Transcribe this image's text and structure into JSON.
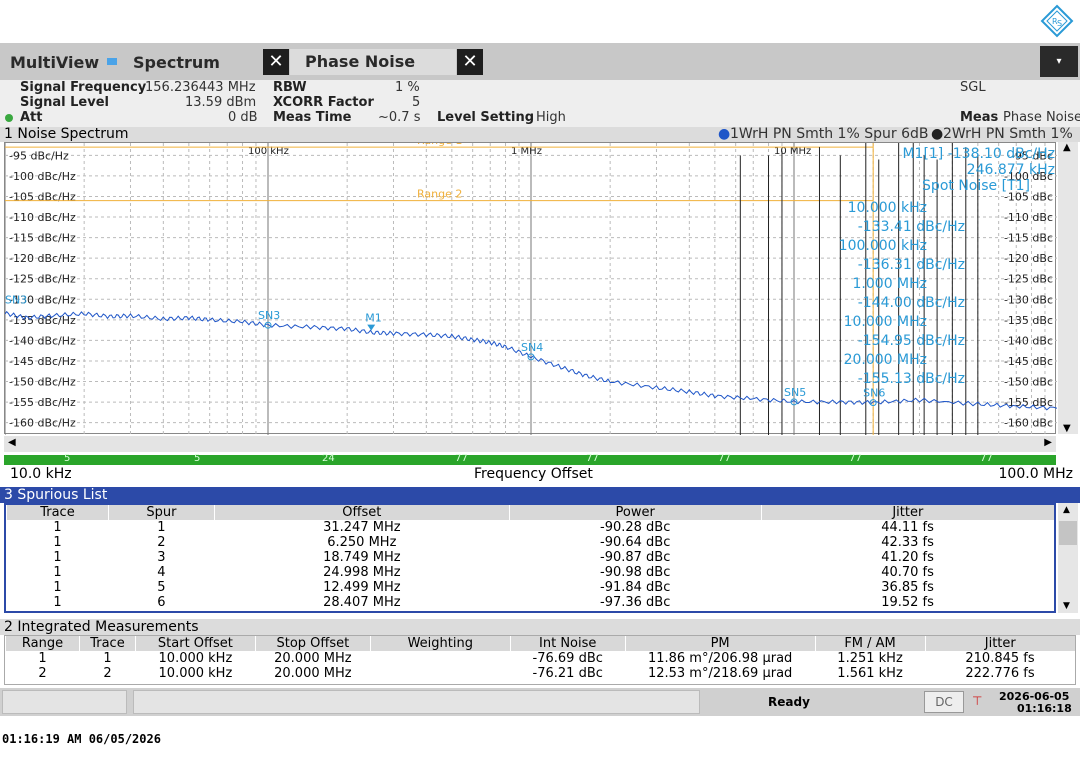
{
  "logo_icon": "rohde-schwarz-diamond-icon",
  "tabs": {
    "multiview": "MultiView",
    "spectrum": "Spectrum",
    "phase_noise": "Phase Noise",
    "close_glyph": "✕",
    "menu_glyph": "▾"
  },
  "info": {
    "signal_frequency_label": "Signal Frequency",
    "signal_frequency_value": "156.236443 MHz",
    "signal_level_label": "Signal Level",
    "signal_level_value": "13.59 dBm",
    "att_label": "Att",
    "att_value": "0 dB",
    "rbw_label": "RBW",
    "rbw_value": "1 %",
    "xcorr_label": "XCORR Factor",
    "xcorr_value": "5",
    "meas_time_label": "Meas Time",
    "meas_time_value": "~0.7 s",
    "level_setting_label": "Level Setting",
    "level_setting_value": "High",
    "sgl": "SGL",
    "meas_label": "Meas",
    "meas_value": "Phase Noise"
  },
  "noise_window": {
    "title": "1 Noise Spectrum",
    "trace1_legend": "1WrH PN Smth 1% Spur 6dB",
    "trace2_legend": "2WrH PN Smth 1%",
    "marker_readout_line1": "M1[1] -138.10 dBc/Hz",
    "marker_readout_line2": "246.877 kHz",
    "spot_noise_title": "Spot Noise [T1]",
    "spot_noise": [
      {
        "freq": "10.000 kHz",
        "val": "-133.41 dBc/Hz"
      },
      {
        "freq": "100.000 kHz",
        "val": "-136.31 dBc/Hz"
      },
      {
        "freq": "1.000 MHz",
        "val": "-144.00 dBc/Hz"
      },
      {
        "freq": "10.000 MHz",
        "val": "-154.95 dBc/Hz"
      },
      {
        "freq": "20.000 MHz",
        "val": "-155.13 dBc/Hz"
      }
    ],
    "range1": "Range 1",
    "range2": "Range 2",
    "green_bar_values": [
      "5",
      "5",
      "24",
      "77",
      "77",
      "77",
      "77",
      "77"
    ],
    "x_start": "10.0 kHz",
    "x_label": "Frequency Offset",
    "x_end": "100.0 MHz"
  },
  "chart_data": {
    "type": "line",
    "x_scale": "log",
    "xlim_hz": [
      10000,
      100000000
    ],
    "ylim": [
      -163,
      -92
    ],
    "x_ticks": [
      "100 kHz",
      "1 MHz",
      "10 MHz"
    ],
    "y_ticks_left": [
      "-95 dBc/Hz",
      "-100 dBc/Hz",
      "-105 dBc/Hz",
      "-110 dBc/Hz",
      "-115 dBc/Hz",
      "-120 dBc/Hz",
      "-125 dBc/Hz",
      "-130 dBc/Hz",
      "-135 dBc/Hz",
      "-140 dBc/Hz",
      "-145 dBc/Hz",
      "-150 dBc/Hz",
      "-155 dBc/Hz",
      "-160 dBc/Hz"
    ],
    "y_ticks_right": [
      "-95 dBc",
      "-100 dBc",
      "-105 dBc",
      "-110 dBc",
      "-115 dBc",
      "-120 dBc",
      "-125 dBc",
      "-130 dBc",
      "-135 dBc",
      "-140 dBc",
      "-145 dBc",
      "-150 dBc",
      "-155 dBc",
      "-160 dBc"
    ],
    "y_tick_values": [
      -95,
      -100,
      -105,
      -110,
      -115,
      -120,
      -125,
      -130,
      -135,
      -140,
      -145,
      -150,
      -155,
      -160
    ],
    "range_lines_dbc": [
      -93,
      -106
    ],
    "series": [
      {
        "x_hz": [
          10000,
          12000,
          15000,
          20000,
          25000,
          30000,
          40000,
          50000,
          60000,
          80000,
          100000,
          150000,
          200000,
          250000,
          300000,
          400000,
          500000,
          600000,
          700000,
          800000,
          1000000,
          1300000,
          1600000,
          2000000,
          3000000,
          4000000,
          5000000,
          7000000,
          10000000,
          15000000,
          20000000,
          30000000,
          50000000,
          70000000,
          100000000
        ],
        "y": [
          -133.4,
          -134.5,
          -134.0,
          -133.5,
          -134.2,
          -134.0,
          -134.8,
          -134.5,
          -135.0,
          -135.5,
          -136.3,
          -136.8,
          -137.2,
          -138.1,
          -138.3,
          -138.6,
          -139.0,
          -139.8,
          -140.5,
          -141.5,
          -144.0,
          -146.5,
          -148.5,
          -150.0,
          -151.5,
          -152.5,
          -153.5,
          -154.2,
          -154.9,
          -155.0,
          -155.1,
          -154.5,
          -155.5,
          -156.0,
          -156.5
        ]
      }
    ],
    "spurs_hz": [
      6250000,
      8000000,
      9000000,
      12499000,
      15000000,
      18749000,
      21000000,
      24998000,
      28407000,
      31247000,
      35000000,
      40000000,
      45000000,
      50000000
    ],
    "markers": [
      {
        "label": "SN3",
        "x_hz": 100000,
        "y": -136.3
      },
      {
        "label": "M1",
        "x_hz": 246877,
        "y": -138.1
      },
      {
        "label": "SN4",
        "x_hz": 1000000,
        "y": -144.0
      },
      {
        "label": "SN5",
        "x_hz": 10000000,
        "y": -154.95
      },
      {
        "label": "SN6",
        "x_hz": 20000000,
        "y": -155.13
      }
    ],
    "sn_left_label": "SN3"
  },
  "spurious": {
    "title": "3 Spurious List",
    "headers": [
      "Trace",
      "Spur",
      "Offset",
      "Power",
      "Jitter"
    ],
    "rows": [
      [
        "1",
        "1",
        "31.247 MHz",
        "-90.28 dBc",
        "44.11 fs"
      ],
      [
        "1",
        "2",
        "6.250 MHz",
        "-90.64 dBc",
        "42.33 fs"
      ],
      [
        "1",
        "3",
        "18.749 MHz",
        "-90.87 dBc",
        "41.20 fs"
      ],
      [
        "1",
        "4",
        "24.998 MHz",
        "-90.98 dBc",
        "40.70 fs"
      ],
      [
        "1",
        "5",
        "12.499 MHz",
        "-91.84 dBc",
        "36.85 fs"
      ],
      [
        "1",
        "6",
        "28.407 MHz",
        "-97.36 dBc",
        "19.52 fs"
      ]
    ]
  },
  "integrated": {
    "title": "2 Integrated Measurements",
    "headers": [
      "Range",
      "Trace",
      "Start Offset",
      "Stop Offset",
      "Weighting",
      "Int Noise",
      "PM",
      "FM / AM",
      "Jitter"
    ],
    "rows": [
      [
        "1",
        "1",
        "10.000 kHz",
        "20.000 MHz",
        "",
        "-76.69 dBc",
        "11.86 m°/206.98 µrad",
        "1.251 kHz",
        "210.845 fs"
      ],
      [
        "2",
        "2",
        "10.000 kHz",
        "20.000 MHz",
        "",
        "-76.21 dBc",
        "12.53 m°/218.69 µrad",
        "1.561 kHz",
        "222.776 fs"
      ]
    ]
  },
  "status": {
    "ready": "Ready",
    "dc": "DC",
    "date": "2026-06-05",
    "time": "01:16:18",
    "network_icon": "network-icon"
  },
  "screenshot_timestamp": "01:16:19 AM  06/05/2026",
  "colors": {
    "trace": "#1f56c8",
    "marker_text": "#2a9ad6",
    "range_line": "#f0b03a",
    "grid": "#888888",
    "spur_title_bg": "#2c4aa8",
    "green_bar": "#2aa52a"
  }
}
